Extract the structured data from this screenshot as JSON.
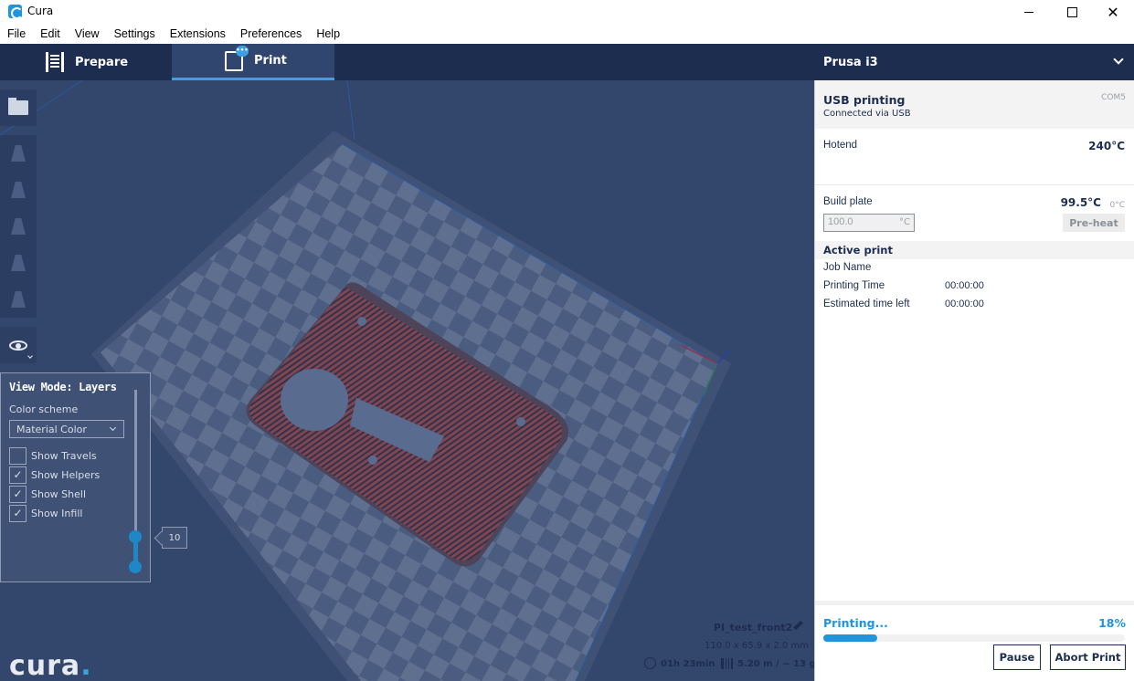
{
  "window": {
    "title": "Cura",
    "minimize_label": "",
    "close_label": "✕"
  },
  "menu": [
    "File",
    "Edit",
    "View",
    "Settings",
    "Extensions",
    "Preferences",
    "Help"
  ],
  "nav": {
    "tab_prepare": "Prepare",
    "tab_print": "Print",
    "printer_name": "Prusa i3"
  },
  "view_panel": {
    "title": "View Mode: Layers",
    "color_scheme_label": "Color scheme",
    "color_scheme_value": "Material Color",
    "checkboxes": [
      {
        "label": "Show Travels",
        "checked": false,
        "mark": ""
      },
      {
        "label": "Show Helpers",
        "checked": true,
        "mark": "✓"
      },
      {
        "label": "Show Shell",
        "checked": true,
        "mark": "✓"
      },
      {
        "label": "Show Infill",
        "checked": true,
        "mark": "✓"
      }
    ],
    "layer_number": "10"
  },
  "logo": {
    "text": "cura",
    "dot": "."
  },
  "object": {
    "name": "PI_test_front2",
    "dimensions": "110.0 x 65.9 x 2.0 mm",
    "print_time": "01h 23min",
    "material": "5.20 m / ~ 13 g"
  },
  "monitor": {
    "connection_title": "USB printing",
    "connection_subtitle": "Connected via USB",
    "port": "COM5",
    "hotend_label": "Hotend",
    "hotend_temp": "240°C",
    "bed_label": "Build plate",
    "bed_temp": "99.5°C",
    "bed_target": "0°C",
    "preheat_value": "100.0",
    "preheat_unit": "°C",
    "preheat_button": "Pre-heat",
    "active_print_title": "Active print",
    "job_name_label": "Job Name",
    "printing_time_label": "Printing Time",
    "printing_time_value": "00:00:00",
    "time_left_label": "Estimated time left",
    "time_left_value": "00:00:00",
    "progress_label": "Printing...",
    "progress_percent": "18%",
    "progress_fraction": 0.18,
    "pause_button": "Pause",
    "abort_button": "Abort Print"
  },
  "colors": {
    "nav_bg": "#1d2d4f",
    "accent": "#1f95dd",
    "viewport_bg": "#3b4d6f",
    "model_color": "#9a4a4a"
  },
  "icons": [
    "cura-app-icon",
    "prepare-icon",
    "print-icon",
    "folder-open-icon",
    "eye-icon",
    "edit-icon",
    "clock-icon",
    "spool-icon",
    "chevron-down-icon"
  ]
}
